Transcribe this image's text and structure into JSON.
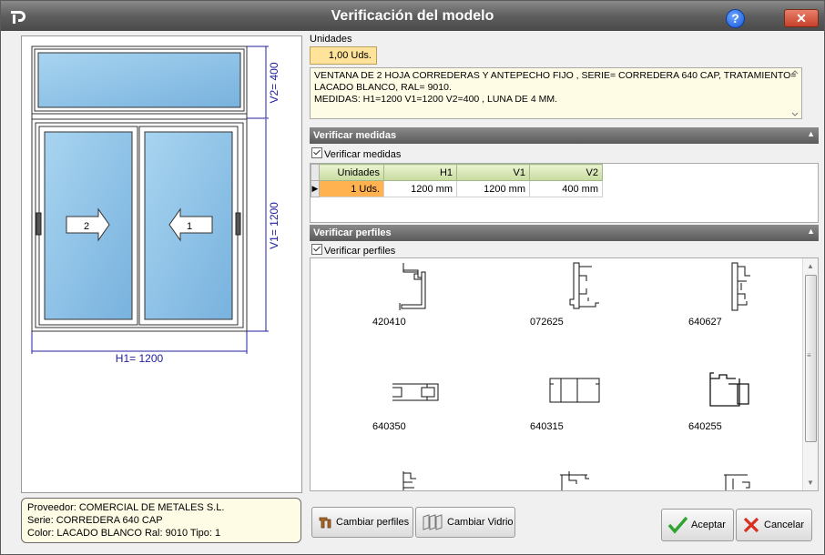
{
  "window": {
    "title": "Verificación del modelo"
  },
  "preview": {
    "h1_label": "H1= 1200",
    "v1_label": "V1= 1200",
    "v2_label": "V2= 400",
    "sash_left_number": "2",
    "sash_right_number": "1"
  },
  "info": {
    "proveedor": "Proveedor: COMERCIAL DE METALES S.L.",
    "serie": "Serie: CORREDERA 640 CAP",
    "color": "Color: LACADO BLANCO  Ral: 9010  Tipo: 1"
  },
  "units": {
    "label": "Unidades",
    "value": "1,00 Uds."
  },
  "description": {
    "line1": "VENTANA DE 2 HOJA CORREDERAS Y ANTEPECHO FIJO , SERIE= CORREDERA 640 CAP,  TRATAMIENTO=",
    "line2": "LACADO BLANCO, RAL= 9010.",
    "line3": "MEDIDAS: H1=1200 V1=1200 V2=400  , LUNA DE 4 MM."
  },
  "verificar_medidas": {
    "header": "Verificar medidas",
    "checkbox_label": "Verificar medidas",
    "columns": [
      "Unidades",
      "H1",
      "V1",
      "V2"
    ],
    "row": [
      "1 Uds.",
      "1200 mm",
      "1200 mm",
      "400 mm"
    ]
  },
  "verificar_perfiles": {
    "header": "Verificar perfiles",
    "checkbox_label": "Verificar perfiles",
    "profiles": [
      "420410",
      "072625",
      "640627",
      "640350",
      "640315",
      "640255"
    ]
  },
  "buttons": {
    "cambiar_perfiles": "Cambiar perfiles",
    "cambiar_vidrio": "Cambiar Vidrio",
    "aceptar": "Aceptar",
    "cancelar": "Cancelar"
  },
  "colors": {
    "title_bar": "#5e5e5e",
    "units_highlight": "#ffe39a",
    "glass": "#8cc4ea",
    "dimension": "#2020a0"
  }
}
